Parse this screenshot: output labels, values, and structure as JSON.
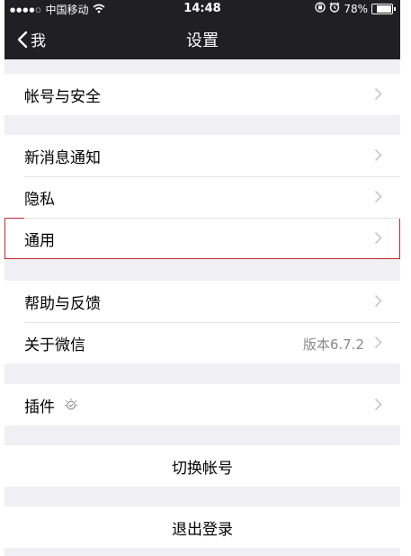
{
  "status_bar": {
    "signal_dots": "●●●●○",
    "carrier": "中国移动",
    "time": "14:48",
    "battery_percent": "78%",
    "battery_level": 0.78
  },
  "nav": {
    "back_label": "我",
    "title": "设置"
  },
  "groups": {
    "account": {
      "security": "帐号与安全"
    },
    "prefs": {
      "notifications": "新消息通知",
      "privacy": "隐私",
      "general": "通用"
    },
    "info": {
      "help": "帮助与反馈",
      "about": "关于微信",
      "version": "版本6.7.2"
    },
    "plugins": {
      "label": "插件"
    },
    "switch_account": "切换帐号",
    "logout": "退出登录"
  },
  "colors": {
    "nav_background": "#1f1f24",
    "page_background": "#efeff4",
    "highlight_border": "#c62b2b",
    "chevron": "#c7c7cc"
  }
}
